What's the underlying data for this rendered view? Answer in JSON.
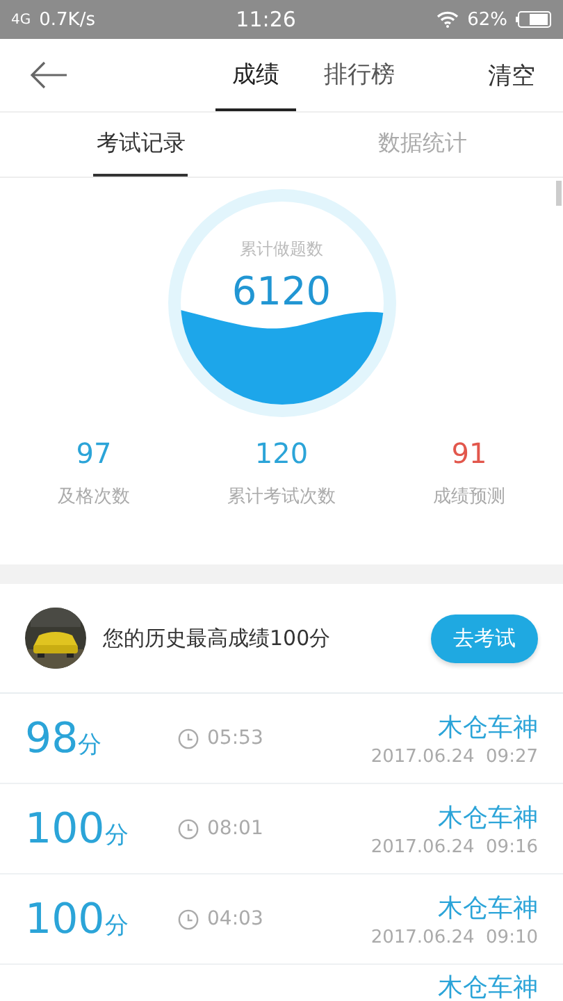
{
  "status_bar": {
    "network": "4G",
    "speed": "0.7K/s",
    "time": "11:26",
    "battery": "62%"
  },
  "nav": {
    "tabs": [
      {
        "label": "成绩",
        "selected": true
      },
      {
        "label": "排行榜",
        "selected": false
      }
    ],
    "action": "清空"
  },
  "subtabs": [
    {
      "label": "考试记录",
      "selected": true
    },
    {
      "label": "数据统计",
      "selected": false
    }
  ],
  "progress": {
    "label": "累计做题数",
    "value": "6120"
  },
  "stats": [
    {
      "value": "97",
      "label": "及格次数",
      "kind": "normal"
    },
    {
      "value": "120",
      "label": "累计考试次数",
      "kind": "normal"
    },
    {
      "value": "91",
      "label": "成绩预测",
      "kind": "alert"
    }
  ],
  "best": {
    "text": "您的历史最高成绩100分",
    "button": "去考试"
  },
  "records": [
    {
      "score": "98",
      "unit": "分",
      "duration": "05:53",
      "name": "木仓车神",
      "date": "2017.06.24  09:27"
    },
    {
      "score": "100",
      "unit": "分",
      "duration": "08:01",
      "name": "木仓车神",
      "date": "2017.06.24  09:16"
    },
    {
      "score": "100",
      "unit": "分",
      "duration": "04:03",
      "name": "木仓车神",
      "date": "2017.06.24  09:10"
    },
    {
      "name": "木仓车神"
    }
  ]
}
